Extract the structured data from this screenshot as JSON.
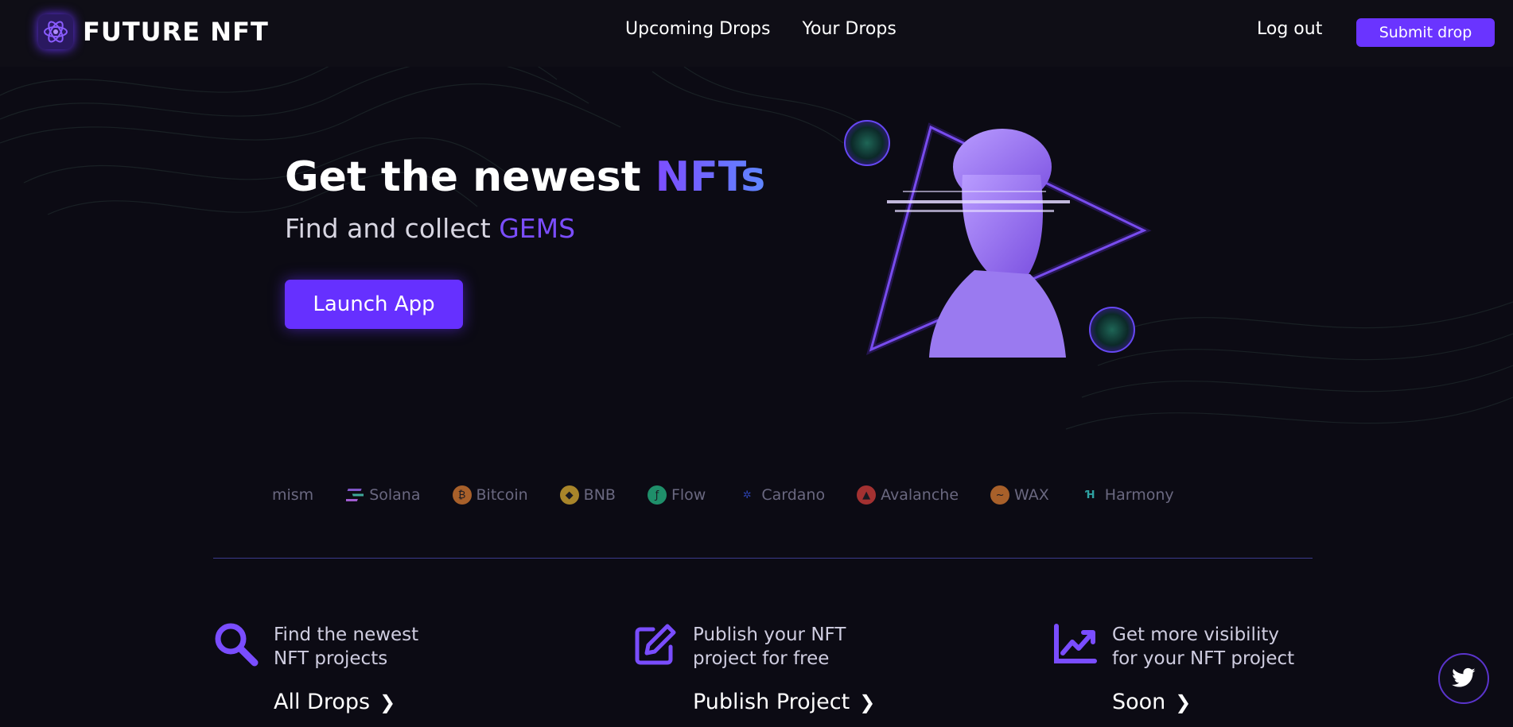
{
  "brand": {
    "name": "FUTURE NFT",
    "icon": "atom-icon",
    "accent": "#6a34ff"
  },
  "nav": {
    "links": [
      "Upcoming Drops",
      "Your Drops"
    ],
    "logout": "Log out",
    "submit": "Submit drop"
  },
  "hero": {
    "title_main": "Get the newest ",
    "title_accent": "NFTs",
    "subtitle_main": "Find and collect ",
    "subtitle_accent": "GEMS",
    "cta": "Launch App",
    "art": "statue-bust-illustration"
  },
  "chains": [
    {
      "label": "mism",
      "icon": "",
      "color": ""
    },
    {
      "label": "Solana",
      "icon": "solana-icon",
      "color": "#7f55c8"
    },
    {
      "label": "Bitcoin",
      "icon": "bitcoin-icon",
      "color": "#a8602a"
    },
    {
      "label": "BNB",
      "icon": "bnb-icon",
      "color": "#a8852a"
    },
    {
      "label": "Flow",
      "icon": "flow-icon",
      "color": "#1f8f6a"
    },
    {
      "label": "Cardano",
      "icon": "cardano-icon",
      "color": "#2a3fa8"
    },
    {
      "label": "Avalanche",
      "icon": "avalanche-icon",
      "color": "#a33131"
    },
    {
      "label": "WAX",
      "icon": "wax-icon",
      "color": "#a8602a"
    },
    {
      "label": "Harmony",
      "icon": "harmony-icon",
      "color": "#2fa3a3"
    }
  ],
  "features": [
    {
      "line1": "Find the newest",
      "line2": "NFT projects",
      "link": "All Drops",
      "icon": "search-icon"
    },
    {
      "line1": "Publish your NFT",
      "line2": "project for free",
      "link": "Publish Project",
      "icon": "edit-icon"
    },
    {
      "line1": "Get more visibility",
      "line2": "for your NFT project",
      "link": "Soon",
      "icon": "chart-up-icon"
    }
  ],
  "social": {
    "icon": "twitter-icon"
  }
}
